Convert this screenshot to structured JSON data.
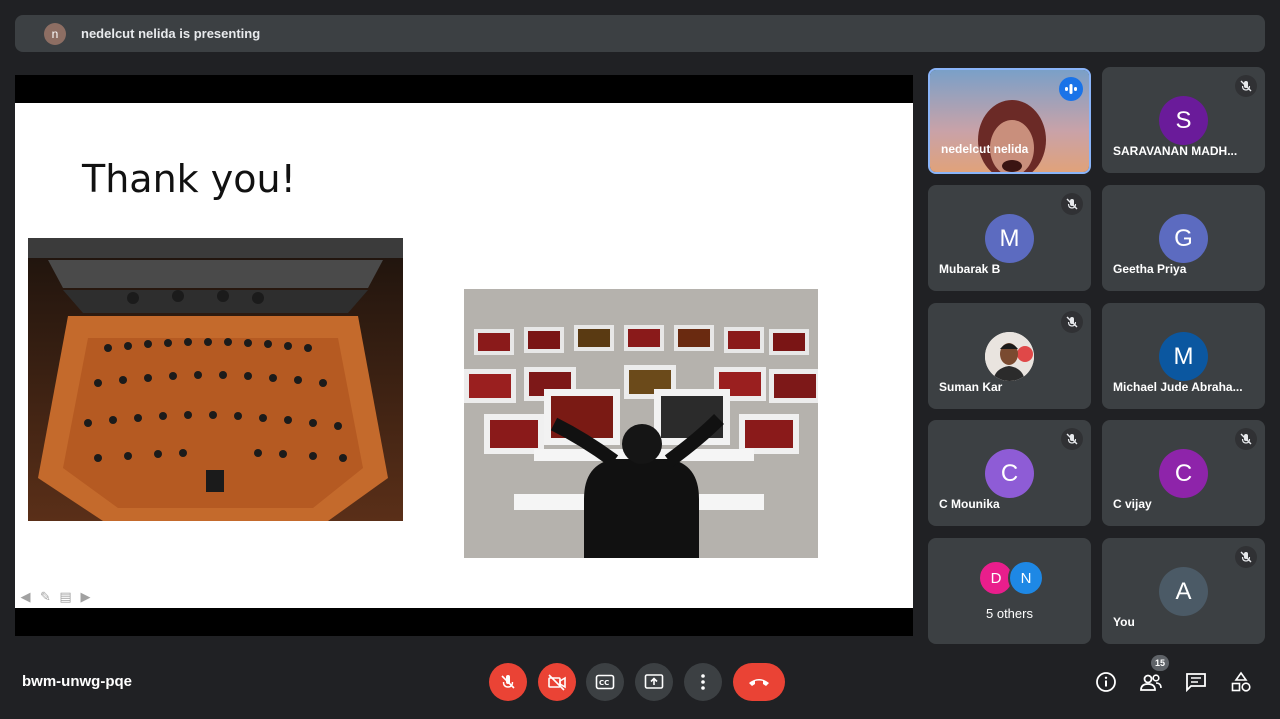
{
  "presenter_bar": {
    "avatar_letter": "n",
    "text": "nedelcut nelida is presenting"
  },
  "slide": {
    "title": "Thank you!"
  },
  "participants": [
    {
      "name": "nedelcut nelida",
      "speaking": true
    },
    {
      "name": "SARAVANAN MADH...",
      "letter": "S",
      "color": "#6a1b9a"
    },
    {
      "name": "Mubarak B",
      "letter": "M",
      "color": "#5c6bc0"
    },
    {
      "name": "Geetha Priya",
      "letter": "G",
      "color": "#5c6bc0"
    },
    {
      "name": "Suman Kar"
    },
    {
      "name": "Michael Jude Abraha...",
      "letter": "M",
      "color": "#0b57a0"
    },
    {
      "name": "C Mounika",
      "letter": "C",
      "color": "#8e5cd6"
    },
    {
      "name": "C vijay",
      "letter": "C",
      "color": "#8e24aa"
    },
    {
      "name": "You",
      "letter": "A",
      "color": "#4b5a66"
    }
  ],
  "others": {
    "letters": [
      "D",
      "N"
    ],
    "colors": [
      "#e91e8c",
      "#1e88e5"
    ],
    "label": "5 others"
  },
  "bottom": {
    "meeting_code": "bwm-unwg-pqe",
    "people_count": "15"
  },
  "colors": {
    "red": "#ea4335",
    "control_gray": "#3c4043",
    "tile_bg": "#3c4043",
    "active_border": "#8ab4f8"
  }
}
